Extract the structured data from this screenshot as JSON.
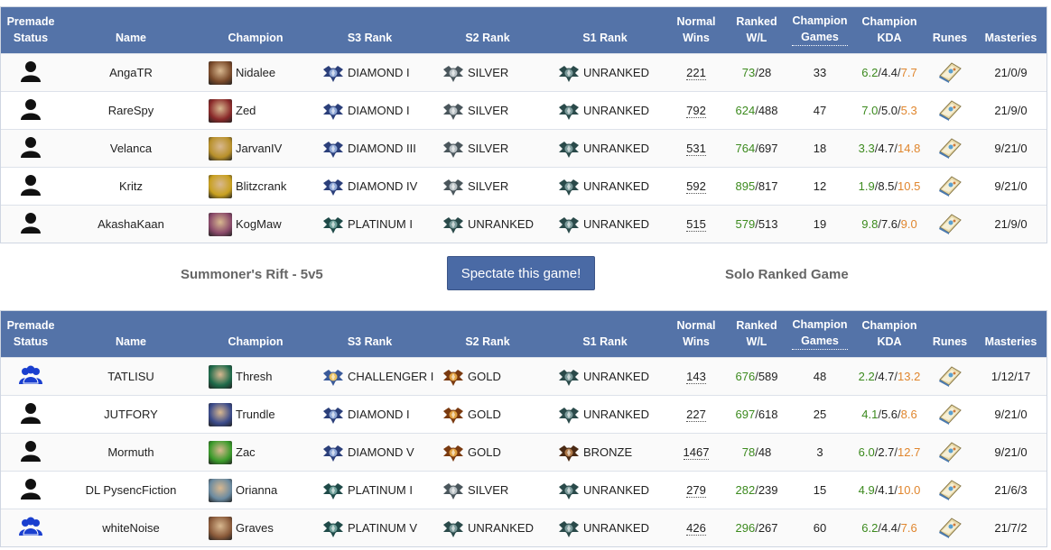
{
  "headers": {
    "premade": [
      "Premade",
      "Status"
    ],
    "name": "Name",
    "champion": "Champion",
    "s3": "S3 Rank",
    "s2": "S2 Rank",
    "s1": "S1 Rank",
    "normal": [
      "Normal",
      "Wins"
    ],
    "ranked": [
      "Ranked",
      "W/L"
    ],
    "champ_games": [
      "Champion",
      "Games"
    ],
    "champ_kda": [
      "Champion",
      "KDA"
    ],
    "runes": "Runes",
    "masteries": "Masteries"
  },
  "colors": {
    "header_bg": "#5473a8",
    "wins": "#3c8a1e",
    "assists": "#e0862e",
    "premade_blue": "#1a3fcf"
  },
  "team1": [
    {
      "premade": "solo",
      "premade_icon": "person-icon",
      "name": "AngaTR",
      "champion": "Nidalee",
      "champ_color": "#7a4a2a",
      "s3": "DIAMOND I",
      "s3_tier": "diamond",
      "s2": "SILVER",
      "s2_tier": "silver",
      "s1": "UNRANKED",
      "s1_tier": "unranked",
      "normal": "221",
      "rw": "73",
      "rl": "28",
      "games": "33",
      "k": "6.2",
      "d": "4.4",
      "a": "7.7",
      "masteries": "21/0/9"
    },
    {
      "premade": "solo",
      "premade_icon": "person-icon",
      "name": "RareSpy",
      "champion": "Zed",
      "champ_color": "#8a2a2a",
      "s3": "DIAMOND I",
      "s3_tier": "diamond",
      "s2": "SILVER",
      "s2_tier": "silver",
      "s1": "UNRANKED",
      "s1_tier": "unranked",
      "normal": "792",
      "rw": "624",
      "rl": "488",
      "games": "47",
      "k": "7.0",
      "d": "5.0",
      "a": "5.3",
      "masteries": "21/9/0"
    },
    {
      "premade": "solo",
      "premade_icon": "person-icon",
      "name": "Velanca",
      "champion": "JarvanIV",
      "champ_color": "#b8902a",
      "s3": "DIAMOND III",
      "s3_tier": "diamond",
      "s2": "SILVER",
      "s2_tier": "silver",
      "s1": "UNRANKED",
      "s1_tier": "unranked",
      "normal": "531",
      "rw": "764",
      "rl": "697",
      "games": "18",
      "k": "3.3",
      "d": "4.7",
      "a": "14.8",
      "masteries": "9/21/0"
    },
    {
      "premade": "solo",
      "premade_icon": "person-icon",
      "name": "Kritz",
      "champion": "Blitzcrank",
      "champ_color": "#c8a020",
      "s3": "DIAMOND IV",
      "s3_tier": "diamond",
      "s2": "SILVER",
      "s2_tier": "silver",
      "s1": "UNRANKED",
      "s1_tier": "unranked",
      "normal": "592",
      "rw": "895",
      "rl": "817",
      "games": "12",
      "k": "1.9",
      "d": "8.5",
      "a": "10.5",
      "masteries": "9/21/0"
    },
    {
      "premade": "solo",
      "premade_icon": "person-icon",
      "name": "AkashaKaan",
      "champion": "KogMaw",
      "champ_color": "#8a4a6a",
      "s3": "PLATINUM I",
      "s3_tier": "platinum",
      "s2": "UNRANKED",
      "s2_tier": "unranked",
      "s1": "UNRANKED",
      "s1_tier": "unranked",
      "normal": "515",
      "rw": "579",
      "rl": "513",
      "games": "19",
      "k": "9.8",
      "d": "7.6",
      "a": "9.0",
      "masteries": "21/9/0"
    }
  ],
  "middle": {
    "map": "Summoner's Rift - 5v5",
    "spectate": "Spectate this game!",
    "queue": "Solo Ranked Game"
  },
  "team2": [
    {
      "premade": "group",
      "premade_icon": "group-icon",
      "name": "TATLISU",
      "champion": "Thresh",
      "champ_color": "#1e6a4a",
      "s3": "CHALLENGER I",
      "s3_tier": "challenger",
      "s2": "GOLD",
      "s2_tier": "gold",
      "s1": "UNRANKED",
      "s1_tier": "unranked",
      "normal": "143",
      "rw": "676",
      "rl": "589",
      "games": "48",
      "k": "2.2",
      "d": "4.7",
      "a": "13.2",
      "masteries": "1/12/17"
    },
    {
      "premade": "solo",
      "premade_icon": "person-icon",
      "name": "JUTFORY",
      "champion": "Trundle",
      "champ_color": "#3a4a8a",
      "s3": "DIAMOND I",
      "s3_tier": "diamond",
      "s2": "GOLD",
      "s2_tier": "gold",
      "s1": "UNRANKED",
      "s1_tier": "unranked",
      "normal": "227",
      "rw": "697",
      "rl": "618",
      "games": "25",
      "k": "4.1",
      "d": "5.6",
      "a": "8.6",
      "masteries": "9/21/0"
    },
    {
      "premade": "solo",
      "premade_icon": "person-icon",
      "name": "Mormuth",
      "champion": "Zac",
      "champ_color": "#3a9a2a",
      "s3": "DIAMOND V",
      "s3_tier": "diamond",
      "s2": "GOLD",
      "s2_tier": "gold",
      "s1": "BRONZE",
      "s1_tier": "bronze",
      "normal": "1467",
      "rw": "78",
      "rl": "48",
      "games": "3",
      "k": "6.0",
      "d": "2.7",
      "a": "12.7",
      "masteries": "9/21/0"
    },
    {
      "premade": "solo",
      "premade_icon": "person-icon",
      "name": "DL PysencFiction",
      "champion": "Orianna",
      "champ_color": "#6a8aa0",
      "s3": "PLATINUM I",
      "s3_tier": "platinum",
      "s2": "SILVER",
      "s2_tier": "silver",
      "s1": "UNRANKED",
      "s1_tier": "unranked",
      "normal": "279",
      "rw": "282",
      "rl": "239",
      "games": "15",
      "k": "4.9",
      "d": "4.1",
      "a": "10.0",
      "masteries": "21/6/3"
    },
    {
      "premade": "group",
      "premade_icon": "group-icon",
      "name": "whiteNoise",
      "champion": "Graves",
      "champ_color": "#8a5a3a",
      "s3": "PLATINUM V",
      "s3_tier": "platinum",
      "s2": "UNRANKED",
      "s2_tier": "unranked",
      "s1": "UNRANKED",
      "s1_tier": "unranked",
      "normal": "426",
      "rw": "296",
      "rl": "267",
      "games": "60",
      "k": "6.2",
      "d": "4.4",
      "a": "7.6",
      "masteries": "21/7/2"
    }
  ]
}
